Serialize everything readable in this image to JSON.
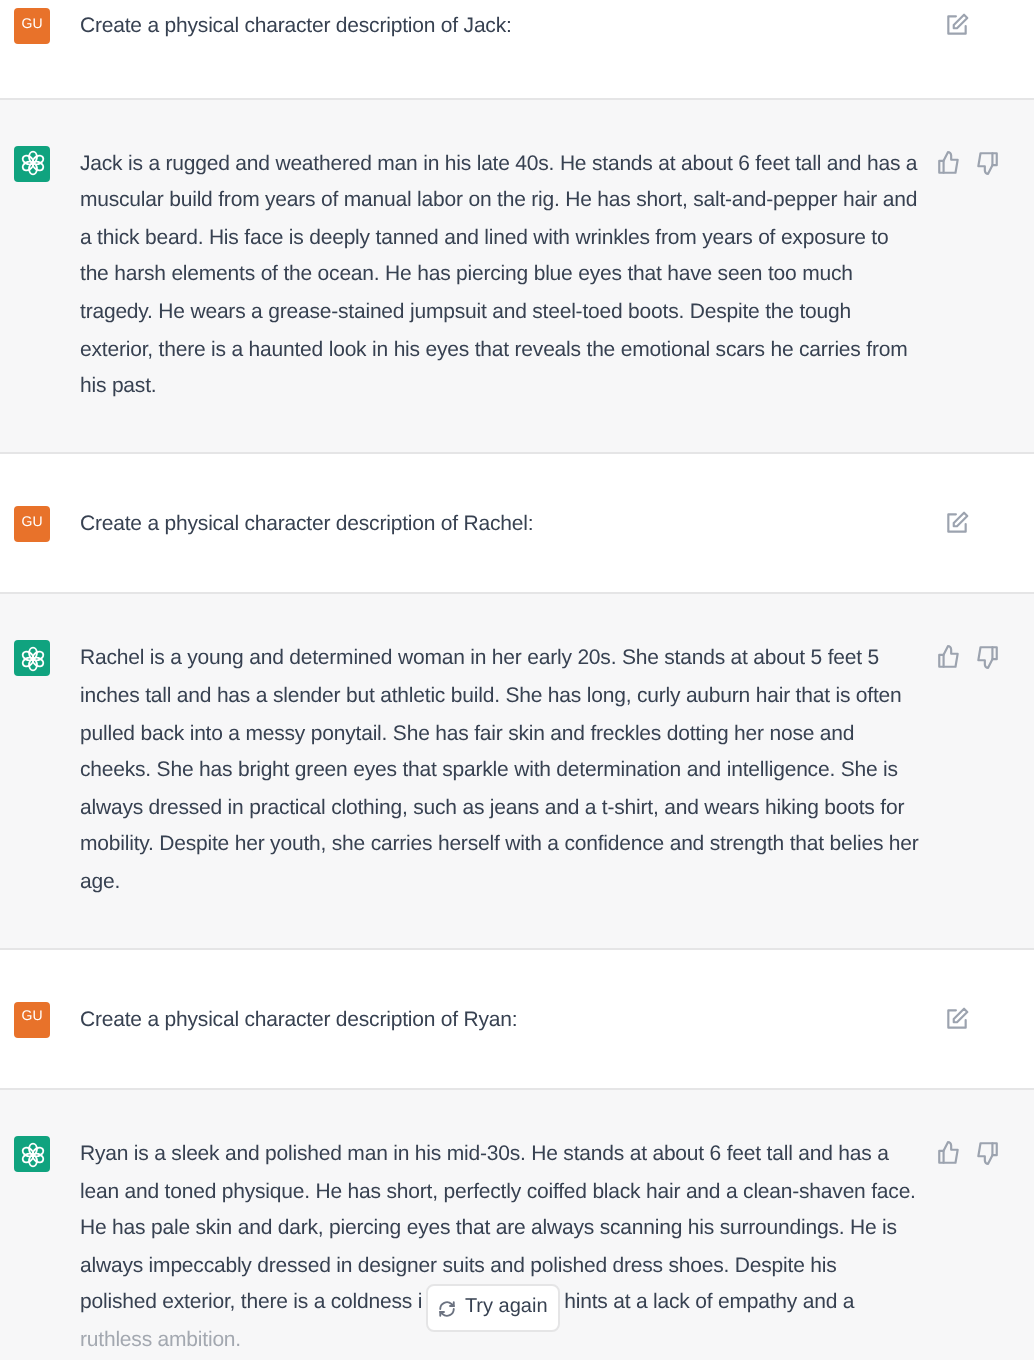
{
  "messages": [
    {
      "kind": "user",
      "avatar": "GU",
      "text": "Create a physical character description of Jack:"
    },
    {
      "kind": "assistant",
      "text": "Jack is a rugged and weathered man in his late 40s. He stands at about 6 feet tall and has a muscular build from years of manual labor on the rig. He has short, salt-and-pepper hair and a thick beard. His face is deeply tanned and lined with wrinkles from years of exposure to the harsh elements of the ocean. He has piercing blue eyes that have seen too much tragedy. He wears a grease-stained jumpsuit and steel-toed boots. Despite the tough exterior, there is a haunted look in his eyes that reveals the emotional scars he carries from his past."
    },
    {
      "kind": "user",
      "avatar": "GU",
      "text": "Create a physical character description of Rachel:"
    },
    {
      "kind": "assistant",
      "text": "Rachel is a young and determined woman in her early 20s. She stands at about 5 feet 5 inches tall and has a slender but athletic build. She has long, curly auburn hair that is often pulled back into a messy ponytail. She has fair skin and freckles dotting her nose and cheeks. She has bright green eyes that sparkle with determination and intelligence. She is always dressed in practical clothing, such as jeans and a t-shirt, and wears hiking boots for mobility. Despite her youth, she carries herself with a confidence and strength that belies her age."
    },
    {
      "kind": "user",
      "avatar": "GU",
      "text": "Create a physical character description of Ryan:"
    },
    {
      "kind": "assistant",
      "text": "Ryan is a sleek and polished man in his mid-30s. He stands at about 6 feet tall and has a lean and toned physique. He has short, perfectly coiffed black hair and a clean-shaven face. He has pale skin and dark, piercing eyes that are always scanning his surroundings. He is always impeccably dressed in designer suits and polished dress shoes. Despite his",
      "covered_line": {
        "before": "polished exterior, there is a coldness i",
        "after": "hints at a lack of empathy and a"
      },
      "last_line": "ruthless ambition."
    }
  ],
  "try_again_button": {
    "label": "Try again"
  }
}
